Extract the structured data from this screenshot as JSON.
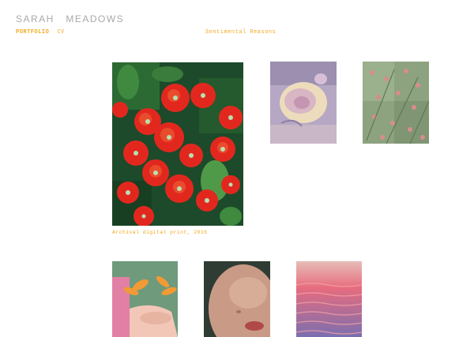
{
  "site": {
    "title": "SARAH   MEADOWS"
  },
  "nav": {
    "portfolio": "PORTFOLIO",
    "cv": "CV"
  },
  "project": {
    "title": "Sentimental Reasons"
  },
  "featured": {
    "caption": "Archival digital print, 2016"
  },
  "colors": {
    "accent": "#f2a91f",
    "title_gray": "#a9a9a9",
    "background": "#ffffff"
  },
  "images": [
    {
      "name": "red-flowers",
      "featured": true
    },
    {
      "name": "pale-rose"
    },
    {
      "name": "green-foliage-with-pink-buds"
    },
    {
      "name": "hand-with-orange-lily"
    },
    {
      "name": "face-closeup"
    },
    {
      "name": "pink-water-ripples"
    }
  ]
}
